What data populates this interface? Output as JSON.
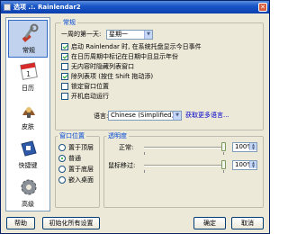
{
  "window": {
    "title": "选项 .:. Rainlendar2"
  },
  "sidebar": {
    "items": [
      {
        "label": "常规",
        "icon": "tools-icon",
        "selected": true
      },
      {
        "label": "日历",
        "icon": "calendar-icon",
        "selected": false
      },
      {
        "label": "皮肤",
        "icon": "skin-icon",
        "selected": false
      },
      {
        "label": "快捷键",
        "icon": "keyboard-icon",
        "selected": false
      },
      {
        "label": "高级",
        "icon": "gear-icon",
        "selected": false
      }
    ]
  },
  "general": {
    "legend": "常规",
    "first_day_label": "一周的第一天:",
    "first_day_value": "星期一",
    "options": [
      {
        "label": "启动 Rainlendar 时, 在系统托盘显示今日事件",
        "checked": true
      },
      {
        "label": "在日历周期中标记在日期中且显示年份",
        "checked": true
      },
      {
        "label": "无内容时隐藏列表窗口",
        "checked": false
      },
      {
        "label": "除列表项 (按住 Shift 拖动添)",
        "checked": true
      },
      {
        "label": "锁定窗口位置",
        "checked": false
      },
      {
        "label": "开机启动运行",
        "checked": false
      }
    ],
    "language_label": "语言:",
    "language_value": "Chinese (Simplified)",
    "more_languages_link": "获取更多语言..."
  },
  "window_position": {
    "legend": "窗口位置",
    "options": [
      {
        "label": "置于顶层",
        "checked": false
      },
      {
        "label": "普通",
        "checked": true
      },
      {
        "label": "置于底层",
        "checked": false
      },
      {
        "label": "嵌入桌面",
        "checked": false
      }
    ]
  },
  "transparency": {
    "legend": "透明度",
    "normal_label": "正常:",
    "normal_value": "100%",
    "normal_level": 1.0,
    "hover_label": "鼠标移过:",
    "hover_value": "100%",
    "hover_level": 1.0
  },
  "buttons": {
    "help": "帮助",
    "reset": "初始化所有设置",
    "ok": "确定",
    "cancel": "取消"
  }
}
